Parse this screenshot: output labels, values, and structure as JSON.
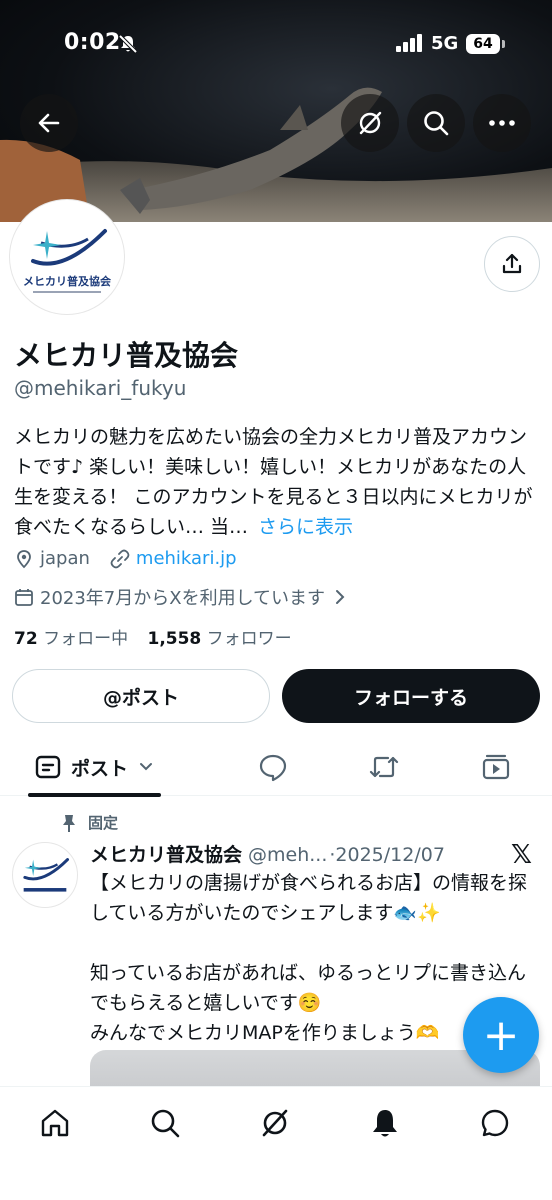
{
  "status_bar": {
    "time": "0:02",
    "network": "5G",
    "battery": "64"
  },
  "profile": {
    "name": "メヒカリ普及協会",
    "handle": "@mehikari_fukyu",
    "bio": "メヒカリの魅力を広めたい協会の全力メヒカリ普及アカウントです♪ 楽しい！美味しい！嬉しい！メヒカリがあなたの人生を変える！ このアカウントを見ると３日以内にメヒカリが食べたくなるらしい… 当…",
    "bio_more": "さらに表示",
    "location": "japan",
    "website": "mehikari.jp",
    "joined": "2023年7月からXを利用しています",
    "following_count": "72",
    "following_label": "フォロー中",
    "followers_count": "1,558",
    "followers_label": "フォロワー",
    "avatar_text": "メヒカリ普及協会"
  },
  "actions": {
    "post_label": "@ポスト",
    "follow_label": "フォローする"
  },
  "tabs": {
    "active_label": "ポスト"
  },
  "tweet": {
    "pinned_label": "固定",
    "name": "メヒカリ普及協会",
    "handle": "@meh...",
    "date": "·2025/12/07",
    "body": "【メヒカリの唐揚げが食べられるお店】の情報を探している方がいたのでシェアします🐟✨\n\n知っているお店があれば、ゆるっとリプに書き込んでもらえると嬉しいです☺️\nみんなでメヒカリMAPを作りましょう🫶"
  },
  "fab_label": "+",
  "colors": {
    "accent": "#1d9bf0",
    "text": "#0f1419",
    "muted": "#536471",
    "border": "#cfd9de"
  }
}
